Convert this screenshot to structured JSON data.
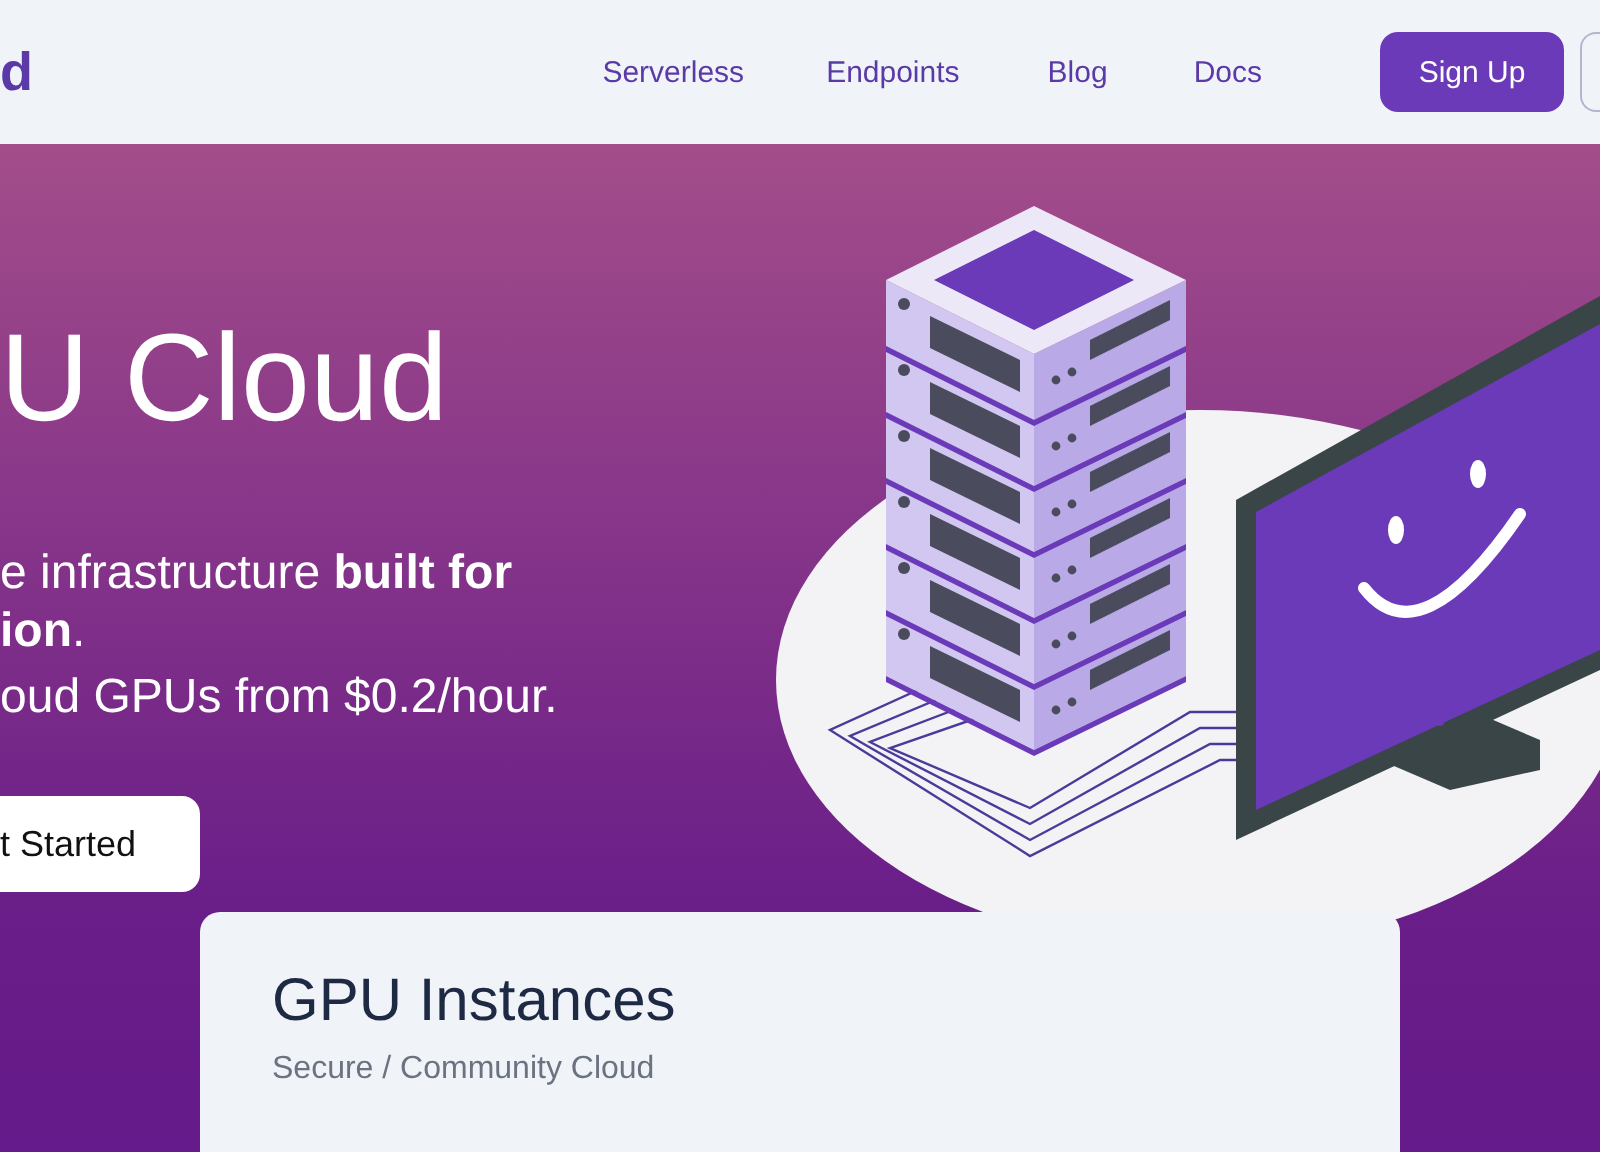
{
  "nav": {
    "logo": "d",
    "links": [
      {
        "label": "Serverless"
      },
      {
        "label": "Endpoints"
      },
      {
        "label": "Blog"
      },
      {
        "label": "Docs"
      }
    ],
    "signup": "Sign Up"
  },
  "hero": {
    "title": "U Cloud",
    "lines": [
      "e infrastructure **built for**",
      "**ion**."
    ],
    "tagline": "oud GPUs from $0.2/hour.",
    "cta": "t Started"
  },
  "card": {
    "title": "GPU Instances",
    "subtitle": "Secure / Community Cloud"
  }
}
